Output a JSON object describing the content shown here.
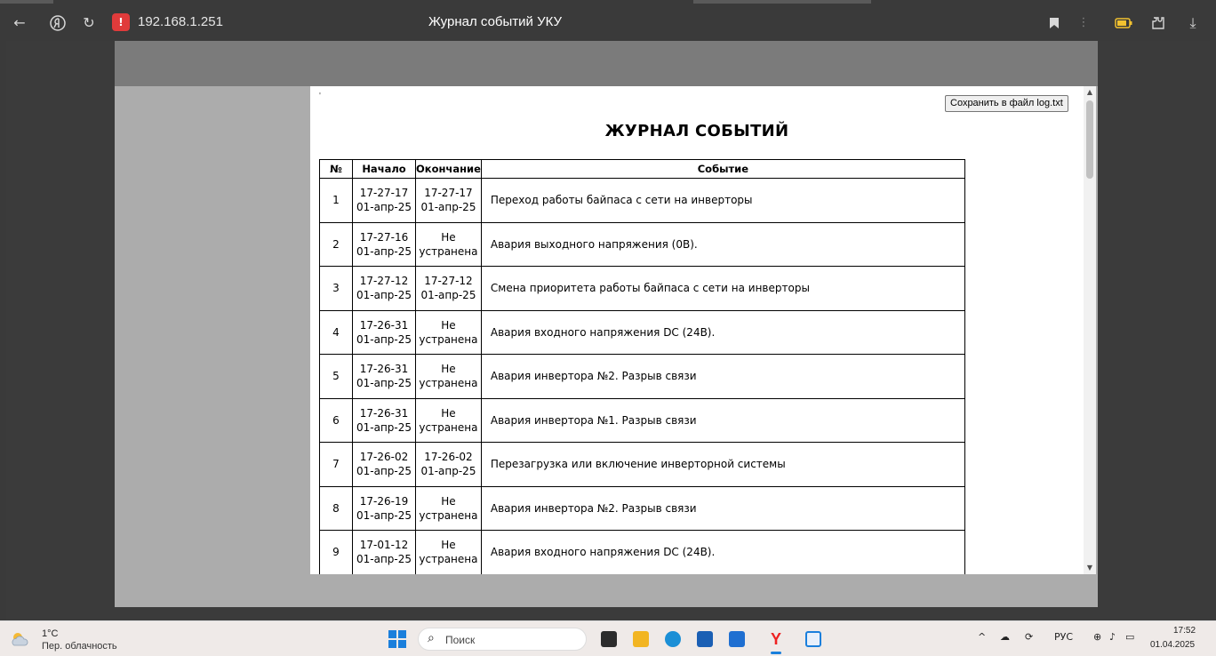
{
  "browser": {
    "url": "192.168.1.251",
    "title": "Журнал событий УКУ",
    "alert_glyph": "!",
    "icons": [
      "back-icon",
      "yandex-icon",
      "reload-icon",
      "bookmark-icon",
      "menu-icon",
      "battery-icon",
      "extension-icon",
      "download-icon"
    ]
  },
  "page": {
    "mark": "'",
    "save_button": "Сохранить в файл log.txt",
    "heading": "ЖУРНАЛ СОБЫТИЙ",
    "columns": [
      "№",
      "Начало",
      "Окончание",
      "Событие"
    ],
    "rows": [
      {
        "num": "1",
        "start_time": "17-27-17",
        "start_date": "01-апр-25",
        "end_time": "17-27-17",
        "end_date": "01-апр-25",
        "event": "Переход работы байпаса с сети на инверторы"
      },
      {
        "num": "2",
        "start_time": "17-27-16",
        "start_date": "01-апр-25",
        "end_time": "Не",
        "end_date": "устранена",
        "event": "Авария выходного напряжения (0В)."
      },
      {
        "num": "3",
        "start_time": "17-27-12",
        "start_date": "01-апр-25",
        "end_time": "17-27-12",
        "end_date": "01-апр-25",
        "event": "Смена приоритета работы байпаса с сети на инверторы"
      },
      {
        "num": "4",
        "start_time": "17-26-31",
        "start_date": "01-апр-25",
        "end_time": "Не",
        "end_date": "устранена",
        "event": "Авария входного напряжения DC (24В)."
      },
      {
        "num": "5",
        "start_time": "17-26-31",
        "start_date": "01-апр-25",
        "end_time": "Не",
        "end_date": "устранена",
        "event": "Авария инвертора №2. Разрыв связи"
      },
      {
        "num": "6",
        "start_time": "17-26-31",
        "start_date": "01-апр-25",
        "end_time": "Не",
        "end_date": "устранена",
        "event": "Авария инвертора №1. Разрыв связи"
      },
      {
        "num": "7",
        "start_time": "17-26-02",
        "start_date": "01-апр-25",
        "end_time": "17-26-02",
        "end_date": "01-апр-25",
        "event": "Перезагрузка или включение инверторной системы"
      },
      {
        "num": "8",
        "start_time": "17-26-19",
        "start_date": "01-апр-25",
        "end_time": "Не",
        "end_date": "устранена",
        "event": "Авария инвертора №2. Разрыв связи"
      },
      {
        "num": "9",
        "start_time": "17-01-12",
        "start_date": "01-апр-25",
        "end_time": "Не",
        "end_date": "устранена",
        "event": "Авария входного напряжения DC (24В)."
      }
    ]
  },
  "taskbar": {
    "weather_temp": "1°C",
    "weather_desc": "Пер. облачность",
    "search_placeholder": "Поиск",
    "language": "РУС",
    "time": "17:52",
    "date": "01.04.2025",
    "colors": {
      "accent": "#1a7fdc",
      "alert": "#e03b3b"
    }
  }
}
